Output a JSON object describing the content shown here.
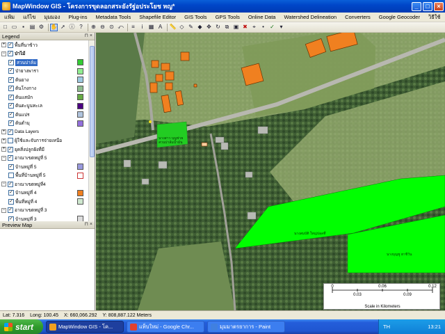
{
  "window": {
    "title": "MapWindow GIS - โครงการขุดลอกสระยังรัฐ่อประโยช หญ*",
    "buttons": [
      "_",
      "□",
      "×"
    ]
  },
  "menu": [
    "แฟ้ม",
    "แก้ไข",
    "มุมมอง",
    "Plug-ins",
    "Metadata Tools",
    "Shapefile Editor",
    "GIS Tools",
    "GPS Tools",
    "Online Data",
    "Watershed Delineation",
    "Converters",
    "Google Geocoder",
    "วิธีใช้"
  ],
  "toolbar_icons": [
    "new-icon",
    "open-icon",
    "save-icon",
    "print-icon",
    "settings-icon",
    "pan-icon",
    "select-icon",
    "identify-icon",
    "help-icon",
    "zoom-in-icon",
    "zoom-out-icon",
    "zoom-extent-icon",
    "zoom-previous-icon",
    "layer-icon",
    "info-icon",
    "table-icon",
    "label-icon",
    "measure-icon",
    "shape-icon",
    "draw-icon",
    "vertex-icon",
    "move-icon",
    "rotate-icon",
    "copy-icon",
    "paste-icon",
    "delete-icon",
    "snap-icon",
    "node-icon",
    "accept-icon",
    "dropdown-icon"
  ],
  "legend": {
    "title": "Legend",
    "items": [
      {
        "label": "พื้นที่นาข้าว",
        "level": 0,
        "checked": true,
        "expand": "+"
      },
      {
        "label": "ป่าไม้",
        "level": 0,
        "checked": true,
        "expand": "−",
        "bold": true
      },
      {
        "label": "สวนปาล์ม",
        "level": 1,
        "checked": true,
        "swatch": "#33cc33",
        "selected": true
      },
      {
        "label": "ป่ายางพารา",
        "level": 1,
        "checked": true,
        "swatch": "#90ee90"
      },
      {
        "label": "ต้นยาง",
        "level": 1,
        "checked": true,
        "swatch": "#9ecae1"
      },
      {
        "label": "ต้นโกงกาง",
        "level": 1,
        "checked": true,
        "swatch": "#8fbc8f"
      },
      {
        "label": "ต้นแสมัก",
        "level": 1,
        "checked": true,
        "swatch": "#66aa44"
      },
      {
        "label": "ต้นตะบูนทะเล",
        "level": 1,
        "checked": true,
        "swatch": "#4b0082"
      },
      {
        "label": "ต้นแปร",
        "level": 1,
        "checked": true,
        "swatch": "#b0c4de"
      },
      {
        "label": "ต้นตำมุ",
        "level": 1,
        "checked": true,
        "swatch": "#9370db"
      },
      {
        "label": "Data Layers",
        "level": 0,
        "checked": true,
        "expand": "+"
      },
      {
        "label": "ผู้ใช้และจับการจ่ายเหนือ",
        "level": 0,
        "checked": false,
        "expand": "+"
      },
      {
        "label": "ยุคสิ่งปลูกฝังที่มี",
        "level": 0,
        "checked": true,
        "expand": "+"
      },
      {
        "label": "อาณาเขตหมู่ที่ 5",
        "level": 0,
        "checked": true,
        "expand": "−"
      },
      {
        "label": "บ้านหมู่ที่ 5",
        "level": 1,
        "checked": true,
        "swatch": "#9999dd"
      },
      {
        "label": "พื้นที่บ้านหมู่ที่ 5",
        "level": 1,
        "checked": false,
        "swatch": "#ffffff",
        "swatch_border": "#cc3333"
      },
      {
        "label": "อาณาเขตหมู่ที่4",
        "level": 0,
        "checked": true,
        "expand": "−"
      },
      {
        "label": "บ้านหมู่ที่ 4",
        "level": 1,
        "checked": true,
        "swatch": "#f08020"
      },
      {
        "label": "พื้นที่หมู่ที่ 4",
        "level": 1,
        "checked": true,
        "swatch": "#cfe8cf"
      },
      {
        "label": "อาณาเขตหมู่ที่ 3",
        "level": 0,
        "checked": true,
        "expand": "−"
      },
      {
        "label": "บ้านหมู่ที่ 3",
        "level": 1,
        "checked": true,
        "swatch": "#dddddd"
      }
    ]
  },
  "preview": {
    "title": "Preview Map"
  },
  "map": {
    "labels": [
      "นางสาว บุญช่วย\nสวนปาล์มน้ำมัน",
      "นางสมบัติ ใหญ่ปลุลที่",
      "นางบุญชู ฮาชีวัน"
    ]
  },
  "scalebar": {
    "ticks": [
      "0",
      "0.03",
      "0.06",
      "0.09",
      "0.12"
    ],
    "label": "Scale in Kilometers"
  },
  "status": {
    "lat": "Lat: 7.316",
    "lon": "Long: 100.45",
    "x": "X: 660,066.292",
    "y": "Y: 808,887.122 Meters"
  },
  "taskbar": {
    "start": "start",
    "tasks": [
      {
        "label": "MapWindow GIS - โค...",
        "active": true,
        "color": "#f0a020"
      },
      {
        "label": "แท็บใหม่ - Google Chr...",
        "active": false,
        "color": "#e04030"
      },
      {
        "label": "มุมมาตรยาการ - Paint",
        "active": false,
        "color": "#4080e0"
      }
    ],
    "lang": "TH",
    "time": "13:21"
  },
  "colors": {
    "accent": "#0a5fd8",
    "building_fill": "#f08020",
    "palm_fill": "#22cc22",
    "field_fill": "#00ff00"
  }
}
